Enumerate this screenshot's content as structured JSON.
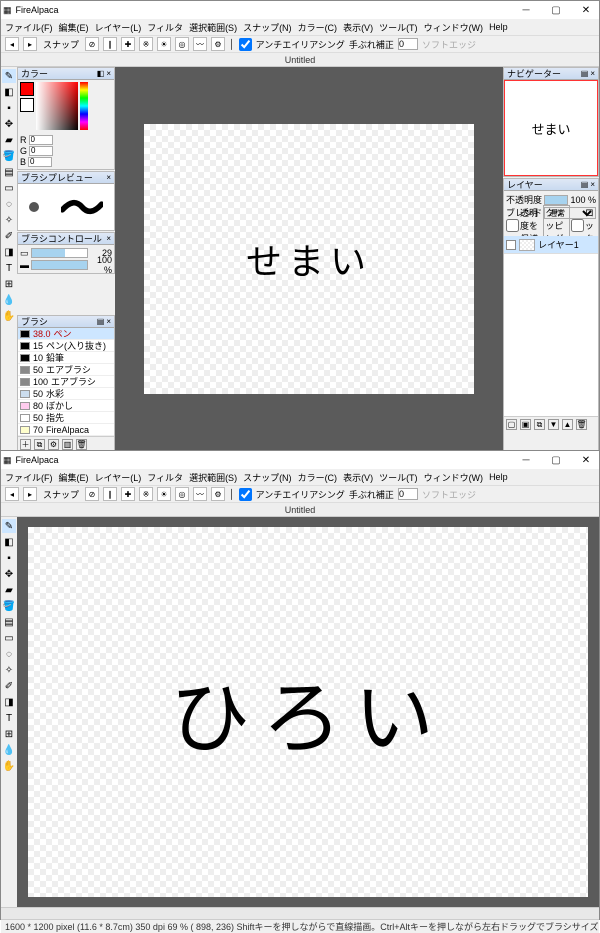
{
  "app_name": "FireAlpaca",
  "menu": [
    "ファイル(F)",
    "編集(E)",
    "レイヤー(L)",
    "フィルタ",
    "選択範囲(S)",
    "スナップ(N)",
    "カラー(C)",
    "表示(V)",
    "ツール(T)",
    "ウィンドウ(W)",
    "Help"
  ],
  "toolbar": {
    "snap_label": "スナップ",
    "antialias_label": "アンチエイリアシング",
    "correction_label": "手ぶれ補正",
    "correction_value": "0",
    "softedge_label": "ソフトエッジ"
  },
  "canvas_title": "Untitled",
  "panels": {
    "color": {
      "title": "カラー",
      "r": "R",
      "g": "G",
      "b": "B",
      "r_val": "0",
      "g_val": "0",
      "b_val": "0"
    },
    "preview": {
      "title": "ブラシプレビュー"
    },
    "control": {
      "title": "ブラシコントロール",
      "size": "29",
      "opacity": "100 %"
    },
    "brush": {
      "title": "ブラシ",
      "items": [
        {
          "size": "38.0",
          "name": "ペン",
          "cls": "black",
          "sel": true
        },
        {
          "size": "15",
          "name": "ペン(入り抜き)",
          "cls": "black"
        },
        {
          "size": "10",
          "name": "鉛筆",
          "cls": "black"
        },
        {
          "size": "50",
          "name": "エアブラシ",
          "cls": "gray"
        },
        {
          "size": "100",
          "name": "エアブラシ",
          "cls": "gray"
        },
        {
          "size": "50",
          "name": "水彩",
          "cls": "lb"
        },
        {
          "size": "80",
          "name": "ぼかし",
          "cls": "pink"
        },
        {
          "size": "50",
          "name": "指先",
          "cls": "white"
        },
        {
          "size": "70",
          "name": "FireAlpaca",
          "cls": "c"
        }
      ]
    },
    "navigator": {
      "title": "ナビゲーター"
    },
    "layer": {
      "title": "レイヤー",
      "opacity_label": "不透明度",
      "opacity_val": "100 %",
      "blend_label": "ブレンド",
      "blend_val": "通常",
      "protect": "透明度を保護",
      "clip": "クリッピング",
      "lock": "ロック",
      "layer1": "レイヤー1"
    }
  },
  "canvas_text_top": "せまい",
  "canvas_text_bottom": "ひろい",
  "status": "1600 * 1200 pixel  (11.6 * 8.7cm)  350 dpi  69 %   ( 898, 236)   Shiftキーを押しながらで直線描画。Ctrl+Altキーを押しながら左右ドラッグでブラシサイズ変更"
}
